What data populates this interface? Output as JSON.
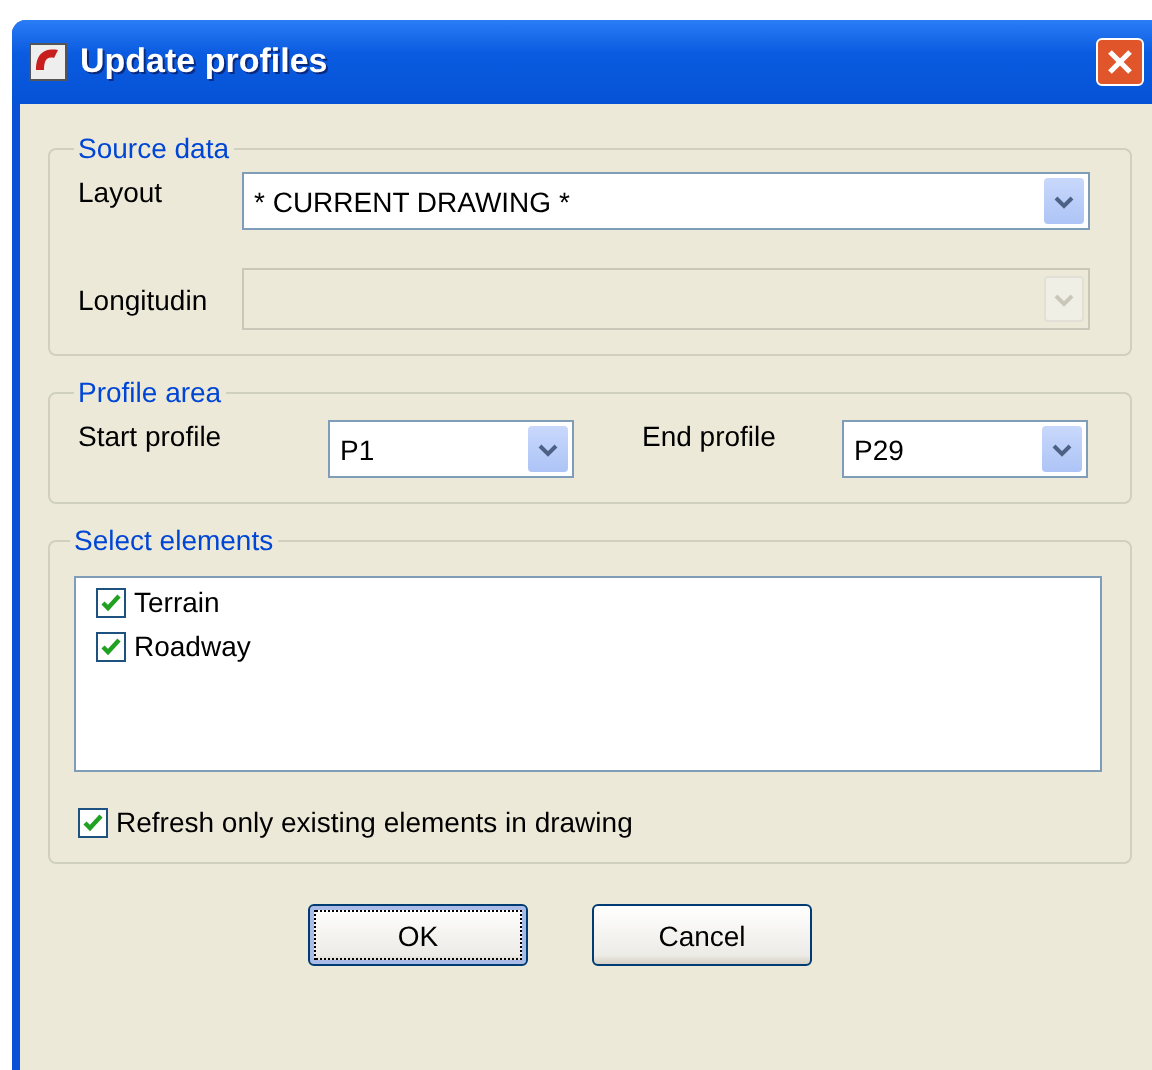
{
  "window": {
    "title": "Update profiles"
  },
  "source_data": {
    "title": "Source data",
    "layout": {
      "label": "Layout",
      "value": "* CURRENT DRAWING *",
      "disabled": false
    },
    "longitudinal": {
      "label": "Longitudin",
      "disabled": true
    }
  },
  "profile_area": {
    "title": "Profile area",
    "start": {
      "label": "Start profile",
      "value": "P1"
    },
    "end": {
      "label": "End profile",
      "value": "P29"
    }
  },
  "select_elements": {
    "title": "Select elements",
    "items": [
      {
        "label": "Terrain",
        "checked": true
      },
      {
        "label": "Roadway",
        "checked": true
      }
    ],
    "refresh": {
      "label": "Refresh only existing elements in drawing",
      "checked": true
    }
  },
  "buttons": [
    {
      "label": "OK",
      "focused": true
    },
    {
      "label": "Cancel",
      "focused": false
    }
  ]
}
